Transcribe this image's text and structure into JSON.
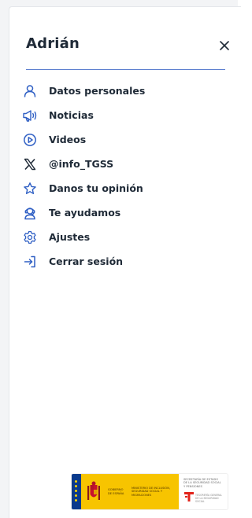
{
  "header": {
    "title": "Adrián",
    "close_label": "×"
  },
  "menu": {
    "items": [
      {
        "label": "Datos personales",
        "icon": "user-icon"
      },
      {
        "label": "Noticias",
        "icon": "megaphone-icon"
      },
      {
        "label": "Videos",
        "icon": "play-circle-icon"
      },
      {
        "label": "@info_TGSS",
        "icon": "x-logo-icon"
      },
      {
        "label": "Danos tu opinión",
        "icon": "star-icon"
      },
      {
        "label": "Te ayudamos",
        "icon": "support-agent-icon"
      },
      {
        "label": "Ajustes",
        "icon": "gear-icon"
      },
      {
        "label": "Cerrar sesión",
        "icon": "logout-icon"
      }
    ]
  },
  "footer": {
    "gobierno": "GOBIERNO DE ESPAÑA",
    "ministerio": "MINISTERIO DE INCLUSIÓN, SEGURIDAD SOCIAL Y MIGRACIONES",
    "secretaria": "SECRETARÍA DE ESTADO DE LA SEGURIDAD SOCIAL Y PENSIONES",
    "tesoreria": "TESORERÍA GENERAL DE LA SEGURIDAD SOCIAL"
  },
  "colors": {
    "accent": "#2f5fc4",
    "text": "#1f2a37",
    "divider": "#5c7fcf",
    "gob_yellow": "#f7c400",
    "tgss_red": "#e2231a"
  }
}
